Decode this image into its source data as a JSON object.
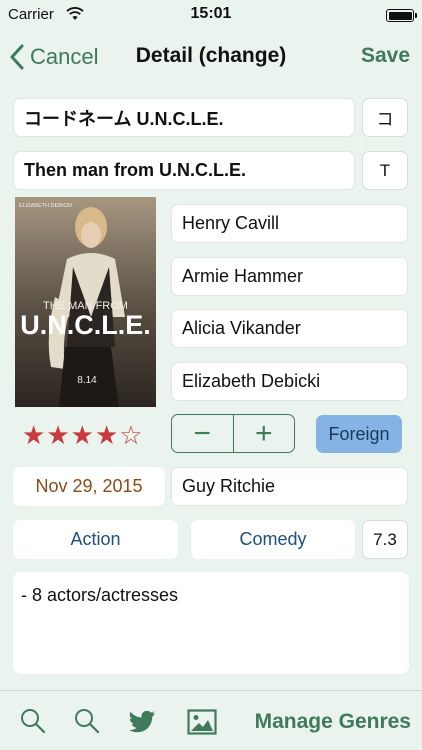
{
  "status_bar": {
    "carrier": "Carrier",
    "time": "15:01",
    "battery_level": 1.0
  },
  "nav": {
    "back_label": "Cancel",
    "title": "Detail (change)",
    "save_label": "Save"
  },
  "titles": {
    "japanese_title": "コードネーム U.N.C.L.E.",
    "japanese_initial": "コ",
    "english_title": "Then man from U.N.C.L.E.",
    "english_initial": "T"
  },
  "poster": {
    "top_name": "ELIZABETH DEBICKI",
    "title_line1": "THE MAN FROM",
    "title_line2": "U.N.C.L.E.",
    "date_text": "8.14"
  },
  "cast": [
    "Henry Cavill",
    "Armie Hammer",
    "Alicia Vikander",
    "Elizabeth Debicki"
  ],
  "rating_stars": {
    "filled": 4,
    "total": 5,
    "color": "#c93a3f"
  },
  "stepper": {
    "minus": "−",
    "plus": "+"
  },
  "foreign_label": "Foreign",
  "watched_date": "Nov 29, 2015",
  "director": "Guy Ritchie",
  "genres": [
    "Action",
    "Comedy"
  ],
  "score": "7.3",
  "notes": "- 8 actors/actresses",
  "toolbar": {
    "icons": [
      "search-icon",
      "search-icon",
      "twitter-icon",
      "image-icon"
    ],
    "manage_label": "Manage Genres"
  },
  "colors": {
    "accent": "#3f7a5b",
    "background": "#eaf3ee",
    "foreign_button": "#85b4e4",
    "date_text": "#8b4a17",
    "genre_text": "#1e4f7e"
  }
}
